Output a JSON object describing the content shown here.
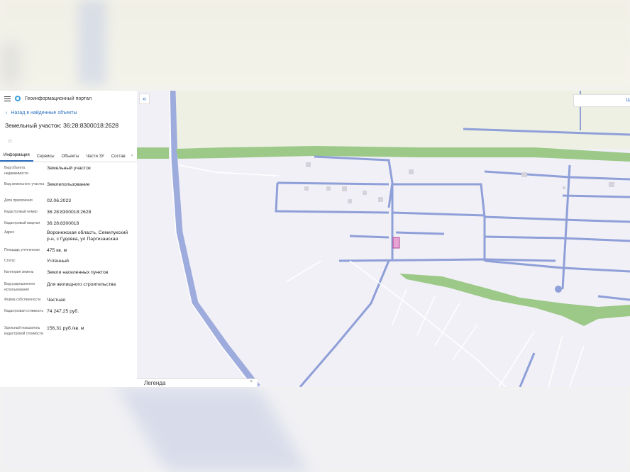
{
  "header": {
    "portal_title": "Геоинформационный портал"
  },
  "nav": {
    "back_label": "Назад в найденные объекты"
  },
  "object": {
    "title": "Земельный участок: 36:28:8300018:2628"
  },
  "tabs": [
    {
      "label": "Информация",
      "active": true
    },
    {
      "label": "Сервисы"
    },
    {
      "label": "Объекты"
    },
    {
      "label": "Части ЗУ"
    },
    {
      "label": "Состав"
    }
  ],
  "properties": [
    {
      "label": "Вид объекта недвижимости",
      "value": "Земельный участок"
    },
    {
      "label": "Вид земельного участка",
      "value": "Землепользование"
    },
    {
      "label": "Дата присвоения",
      "value": "02.06.2023"
    },
    {
      "label": "Кадастровый номер",
      "value": "36:28:8300018:2628"
    },
    {
      "label": "Кадастровый квартал",
      "value": "36:28:8300018"
    },
    {
      "label": "Адрес",
      "value": "Воронежская область, Семилукский р-н, с Гудовка, ул Партизанская"
    },
    {
      "label": "Площадь уточненная",
      "value": "475 кв. м"
    },
    {
      "label": "Статус",
      "value": "Учтенный"
    },
    {
      "label": "Категория земель",
      "value": "Земли населенных пунктов"
    },
    {
      "label": "Вид разрешенного использования",
      "value": "Для жилищного строительства"
    },
    {
      "label": "Форма собственности",
      "value": "Частная"
    },
    {
      "label": "Кадастровая стоимость",
      "value": "74 247,25 руб."
    },
    {
      "label": "Удельный показатель кадастровой стоимости",
      "value": "156,31 руб./кв. м"
    }
  ],
  "map": {
    "legend_label": "Легенда",
    "search_label": "Ш",
    "colors": {
      "road": "#8f9fd8",
      "green": "#9cc987",
      "parcel": "#e7a3d3",
      "background": "#f1f0f7"
    }
  },
  "icons": {
    "collapse": "«",
    "back": "‹",
    "star": "☆",
    "tab_next": "›",
    "legend_toggle": "⌃"
  }
}
